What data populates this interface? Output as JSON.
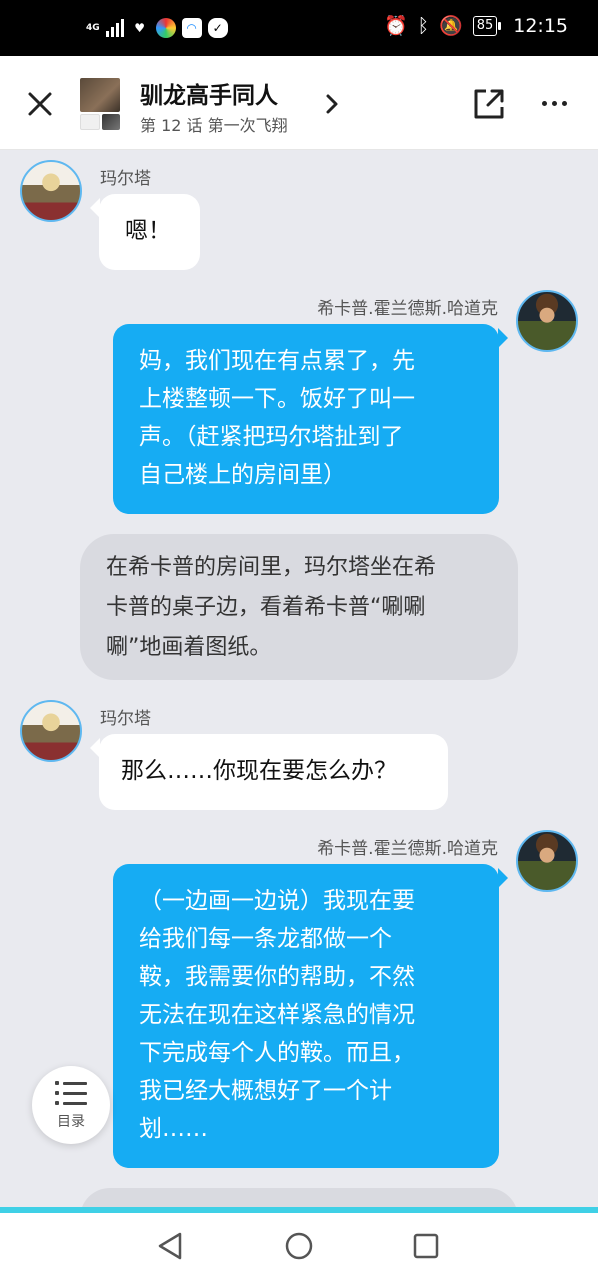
{
  "status_bar": {
    "network": "4G",
    "battery": "85",
    "time": "12:15"
  },
  "header": {
    "title": "驯龙高手同人",
    "subtitle": "第 12 话 第一次飞翔"
  },
  "chat": [
    {
      "speaker": "玛尔塔",
      "text": "嗯！"
    },
    {
      "speaker": "希卡普.霍兰德斯.哈道克",
      "text": "妈，我们现在有点累了，先\n上楼整顿一下。饭好了叫一\n声。（赶紧把玛尔塔扯到了\n自己楼上的房间里）"
    },
    {
      "speaker": "",
      "text": "在希卡普的房间里，玛尔塔坐在希\n卡普的桌子边，看着希卡普“唰唰\n唰”地画着图纸。"
    },
    {
      "speaker": "玛尔塔",
      "text": "那么……你现在要怎么办？"
    },
    {
      "speaker": "希卡普.霍兰德斯.哈道克",
      "text": "（一边画一边说）我现在要\n给我们每一条龙都做一个\n鞍，我需要你的帮助，不然\n无法在现在这样紧急的情况\n下完成每个人的鞍。而且，\n我已经大概想好了一个计\n划……"
    }
  ],
  "toc": {
    "label": "目录"
  },
  "colors": {
    "accent": "#16acf3",
    "progress": "#3fd0e6"
  }
}
